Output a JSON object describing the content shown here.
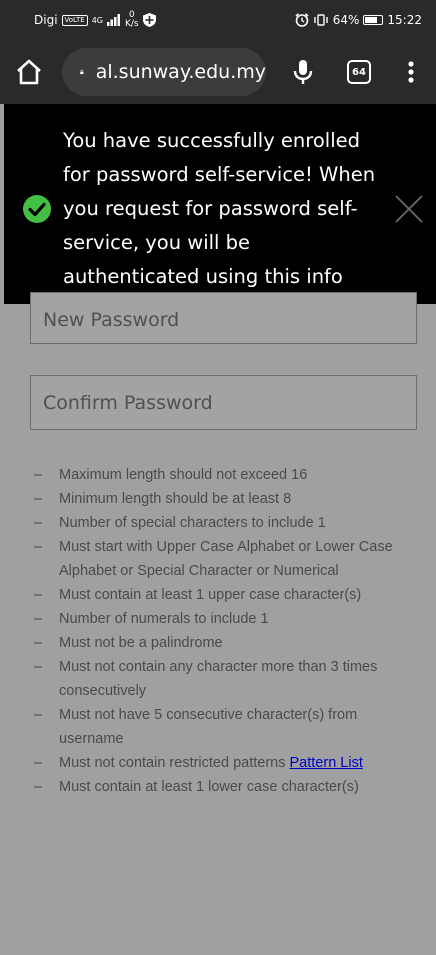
{
  "status_bar": {
    "carrier": "Digi",
    "volte": "VoLTE",
    "signal": "4G",
    "net_speed_value": "0",
    "net_speed_unit": "K/s",
    "battery": "64%",
    "time": "15:22"
  },
  "browser": {
    "url": "al.sunway.edu.my",
    "tab_count": "64"
  },
  "toast": {
    "message": "You have successfully enrolled for password self-service! When you request for password self-service, you will be authenticated using this info"
  },
  "form": {
    "new_password_placeholder": "New Password",
    "confirm_password_placeholder": "Confirm Password"
  },
  "rules": {
    "items": [
      "Maximum length should not exceed 16",
      "Minimum length should be at least 8",
      "Number of special characters to include 1",
      "Must start with Upper Case Alphabet or Lower Case Alphabet or Special Character or Numerical",
      "Must contain at least 1 upper case character(s)",
      "Number of numerals to include 1",
      "Must not be a palindrome",
      "Must not contain any character more than 3 times consecutively",
      "Must not have 5 consecutive character(s) from username",
      "Must not contain restricted patterns",
      "Must contain at least 1 lower case character(s)"
    ],
    "pattern_link": "Pattern List"
  },
  "colors": {
    "toast_bg": "#000000",
    "check_green": "#43c043",
    "link_blue": "#0000c8",
    "page_overlay": "#a0a0a0"
  }
}
